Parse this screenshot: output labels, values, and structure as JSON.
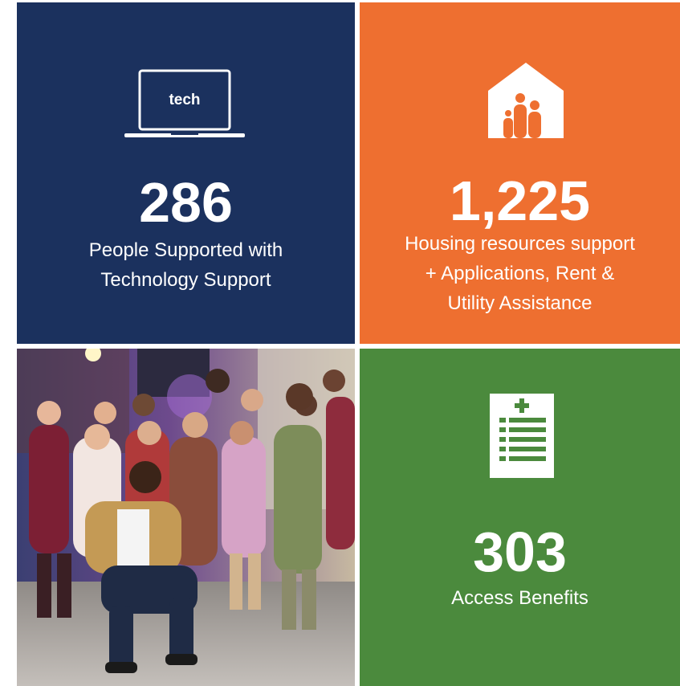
{
  "tiles": {
    "tech": {
      "icon": "laptop-icon",
      "icon_label": "tech",
      "value": "286",
      "caption_lines": [
        "People Supported with",
        "Technology Support"
      ],
      "bg": "#1b315e"
    },
    "housing": {
      "icon": "house-family-icon",
      "value": "1,225",
      "caption_lines": [
        "Housing resources support",
        "+ Applications, Rent &",
        "Utility Assistance"
      ],
      "bg": "#ee6f30"
    },
    "photo": {
      "icon": "group-photo"
    },
    "benefits": {
      "icon": "clipboard-list-icon",
      "value": "303",
      "caption_lines": [
        "Access Benefits"
      ],
      "bg": "#4b8a3d"
    }
  }
}
